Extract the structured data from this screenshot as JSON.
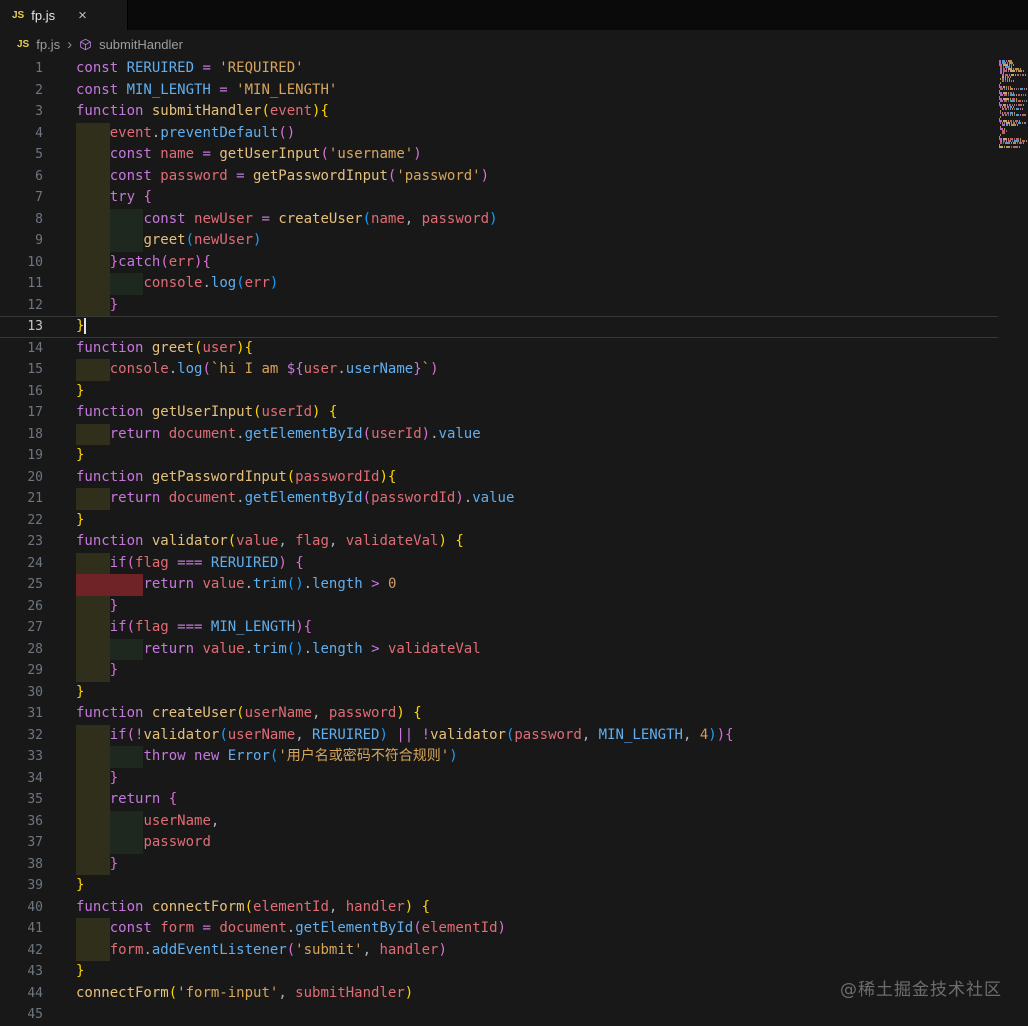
{
  "tab": {
    "icon_label": "JS",
    "title": "fp.js",
    "close_glyph": "×"
  },
  "breadcrumb": {
    "file_icon": "JS",
    "file": "fp.js",
    "separator": "›",
    "symbol": "submitHandler"
  },
  "editor": {
    "active_line": 13,
    "cursor_line": 13,
    "watermark": "@稀土掘金技术社区",
    "colors": {
      "editor_bg": "#181818",
      "tab_bar_bg": "#0a0a0a",
      "tab_active_bg": "#181818",
      "keyword": "#c678dd",
      "function_name": "#e5c07b",
      "variable": "#e06c75",
      "property": "#61afef",
      "string": "#d7a65c",
      "number": "#d19a66",
      "operator": "#c678dd",
      "punctuation": "#abb2bf",
      "bracket_depth_1": "#ffd700",
      "bracket_depth_2": "#da70d6",
      "bracket_depth_3": "#179fff",
      "line_number": "#6e7681",
      "line_number_active": "#c8c8c8",
      "indent_level_1": "rgba(255,255,64,0.10)",
      "indent_level_2": "rgba(127,255,127,0.07)",
      "indent_error": "rgba(150,40,44,0.70)",
      "js_icon": "#e8cf4e",
      "breadcrumb_text": "#9d9d9d",
      "symbol_icon": "#b180d7",
      "watermark": "rgba(235,235,235,0.40)"
    },
    "lines": [
      {
        "n": 1,
        "i": 0,
        "t": [
          [
            "kw",
            "const "
          ],
          [
            "bl",
            "RERUIRED "
          ],
          [
            "op",
            "= "
          ],
          [
            "st",
            "'REQUIRED'"
          ]
        ]
      },
      {
        "n": 2,
        "i": 0,
        "t": [
          [
            "kw",
            "const "
          ],
          [
            "bl",
            "MIN_LENGTH "
          ],
          [
            "op",
            "= "
          ],
          [
            "st",
            "'MIN_LENGTH'"
          ]
        ]
      },
      {
        "n": 3,
        "i": 0,
        "t": [
          [
            "kw",
            "function "
          ],
          [
            "fn",
            "submitHandler"
          ],
          [
            "br",
            "("
          ],
          [
            "vr",
            "event"
          ],
          [
            "br",
            "){"
          ]
        ]
      },
      {
        "n": 4,
        "i": 1,
        "t": [
          [
            "vr",
            "event"
          ],
          [
            "pn",
            "."
          ],
          [
            "bl",
            "preventDefault"
          ],
          [
            "br",
            "()"
          ]
        ]
      },
      {
        "n": 5,
        "i": 1,
        "t": [
          [
            "kw",
            "const "
          ],
          [
            "vr",
            "name "
          ],
          [
            "op",
            "= "
          ],
          [
            "fn",
            "getUserInput"
          ],
          [
            "br",
            "("
          ],
          [
            "st",
            "'username'"
          ],
          [
            "br",
            ")"
          ]
        ]
      },
      {
        "n": 6,
        "i": 1,
        "t": [
          [
            "kw",
            "const "
          ],
          [
            "vr",
            "password "
          ],
          [
            "op",
            "= "
          ],
          [
            "fn",
            "getPasswordInput"
          ],
          [
            "br",
            "("
          ],
          [
            "st",
            "'password'"
          ],
          [
            "br",
            ")"
          ]
        ]
      },
      {
        "n": 7,
        "i": 1,
        "t": [
          [
            "kw",
            "try "
          ],
          [
            "br",
            "{"
          ]
        ]
      },
      {
        "n": 8,
        "i": 2,
        "t": [
          [
            "kw",
            "const "
          ],
          [
            "vr",
            "newUser "
          ],
          [
            "op",
            "= "
          ],
          [
            "fn",
            "createUser"
          ],
          [
            "br",
            "("
          ],
          [
            "vr",
            "name"
          ],
          [
            "pn",
            ", "
          ],
          [
            "vr",
            "password"
          ],
          [
            "br",
            ")"
          ]
        ]
      },
      {
        "n": 9,
        "i": 2,
        "t": [
          [
            "fn",
            "greet"
          ],
          [
            "br",
            "("
          ],
          [
            "vr",
            "newUser"
          ],
          [
            "br",
            ")"
          ]
        ]
      },
      {
        "n": 10,
        "i": 1,
        "t": [
          [
            "br",
            "}"
          ],
          [
            "kw",
            "catch"
          ],
          [
            "br",
            "("
          ],
          [
            "vr",
            "err"
          ],
          [
            "br",
            "){"
          ]
        ]
      },
      {
        "n": 11,
        "i": 2,
        "t": [
          [
            "vr",
            "console"
          ],
          [
            "pn",
            "."
          ],
          [
            "bl",
            "log"
          ],
          [
            "br",
            "("
          ],
          [
            "vr",
            "err"
          ],
          [
            "br",
            ")"
          ]
        ]
      },
      {
        "n": 12,
        "i": 1,
        "t": [
          [
            "br",
            "}"
          ]
        ]
      },
      {
        "n": 13,
        "i": 0,
        "t": [
          [
            "br",
            "}"
          ]
        ]
      },
      {
        "n": 14,
        "i": 0,
        "t": [
          [
            "kw",
            "function "
          ],
          [
            "fn",
            "greet"
          ],
          [
            "br",
            "("
          ],
          [
            "vr",
            "user"
          ],
          [
            "br",
            "){"
          ]
        ]
      },
      {
        "n": 15,
        "i": 1,
        "t": [
          [
            "vr",
            "console"
          ],
          [
            "pn",
            "."
          ],
          [
            "bl",
            "log"
          ],
          [
            "br",
            "("
          ],
          [
            "st",
            "`hi I am "
          ],
          [
            "op",
            "${"
          ],
          [
            "vr",
            "user"
          ],
          [
            "pn",
            "."
          ],
          [
            "bl",
            "userName"
          ],
          [
            "op",
            "}"
          ],
          [
            "st",
            "`"
          ],
          [
            "br",
            ")"
          ]
        ]
      },
      {
        "n": 16,
        "i": 0,
        "t": [
          [
            "br",
            "}"
          ]
        ]
      },
      {
        "n": 17,
        "i": 0,
        "t": [
          [
            "kw",
            "function "
          ],
          [
            "fn",
            "getUserInput"
          ],
          [
            "br",
            "("
          ],
          [
            "vr",
            "userId"
          ],
          [
            "br",
            ") {"
          ]
        ]
      },
      {
        "n": 18,
        "i": 1,
        "t": [
          [
            "kw",
            "return "
          ],
          [
            "vr",
            "document"
          ],
          [
            "pn",
            "."
          ],
          [
            "bl",
            "getElementById"
          ],
          [
            "br",
            "("
          ],
          [
            "vr",
            "userId"
          ],
          [
            "br",
            ")"
          ],
          [
            "pn",
            "."
          ],
          [
            "bl",
            "value"
          ]
        ]
      },
      {
        "n": 19,
        "i": 0,
        "t": [
          [
            "br",
            "}"
          ]
        ]
      },
      {
        "n": 20,
        "i": 0,
        "t": [
          [
            "kw",
            "function "
          ],
          [
            "fn",
            "getPasswordInput"
          ],
          [
            "br",
            "("
          ],
          [
            "vr",
            "passwordId"
          ],
          [
            "br",
            "){"
          ]
        ]
      },
      {
        "n": 21,
        "i": 1,
        "t": [
          [
            "kw",
            "return "
          ],
          [
            "vr",
            "document"
          ],
          [
            "pn",
            "."
          ],
          [
            "bl",
            "getElementById"
          ],
          [
            "br",
            "("
          ],
          [
            "vr",
            "passwordId"
          ],
          [
            "br",
            ")"
          ],
          [
            "pn",
            "."
          ],
          [
            "bl",
            "value"
          ]
        ]
      },
      {
        "n": 22,
        "i": 0,
        "t": [
          [
            "br",
            "}"
          ]
        ]
      },
      {
        "n": 23,
        "i": 0,
        "t": [
          [
            "kw",
            "function "
          ],
          [
            "fn",
            "validator"
          ],
          [
            "br",
            "("
          ],
          [
            "vr",
            "value"
          ],
          [
            "pn",
            ", "
          ],
          [
            "vr",
            "flag"
          ],
          [
            "pn",
            ", "
          ],
          [
            "vr",
            "validateVal"
          ],
          [
            "br",
            ") {"
          ]
        ]
      },
      {
        "n": 24,
        "i": 1,
        "t": [
          [
            "kw",
            "if"
          ],
          [
            "br",
            "("
          ],
          [
            "vr",
            "flag "
          ],
          [
            "op",
            "=== "
          ],
          [
            "bl",
            "RERUIRED"
          ],
          [
            "br",
            ") {"
          ]
        ]
      },
      {
        "n": 25,
        "i": 2,
        "e": true,
        "t": [
          [
            "kw",
            "return "
          ],
          [
            "vr",
            "value"
          ],
          [
            "pn",
            "."
          ],
          [
            "bl",
            "trim"
          ],
          [
            "br",
            "()"
          ],
          [
            "pn",
            "."
          ],
          [
            "bl",
            "length "
          ],
          [
            "op",
            "> "
          ],
          [
            "nm",
            "0"
          ]
        ]
      },
      {
        "n": 26,
        "i": 1,
        "t": [
          [
            "br",
            "}"
          ]
        ]
      },
      {
        "n": 27,
        "i": 1,
        "t": [
          [
            "kw",
            "if"
          ],
          [
            "br",
            "("
          ],
          [
            "vr",
            "flag "
          ],
          [
            "op",
            "=== "
          ],
          [
            "bl",
            "MIN_LENGTH"
          ],
          [
            "br",
            "){"
          ]
        ]
      },
      {
        "n": 28,
        "i": 2,
        "t": [
          [
            "kw",
            "return "
          ],
          [
            "vr",
            "value"
          ],
          [
            "pn",
            "."
          ],
          [
            "bl",
            "trim"
          ],
          [
            "br",
            "()"
          ],
          [
            "pn",
            "."
          ],
          [
            "bl",
            "length "
          ],
          [
            "op",
            "> "
          ],
          [
            "vr",
            "validateVal"
          ]
        ]
      },
      {
        "n": 29,
        "i": 1,
        "t": [
          [
            "br",
            "}"
          ]
        ]
      },
      {
        "n": 30,
        "i": 0,
        "t": [
          [
            "br",
            "}"
          ]
        ]
      },
      {
        "n": 31,
        "i": 0,
        "t": [
          [
            "kw",
            "function "
          ],
          [
            "fn",
            "createUser"
          ],
          [
            "br",
            "("
          ],
          [
            "vr",
            "userName"
          ],
          [
            "pn",
            ", "
          ],
          [
            "vr",
            "password"
          ],
          [
            "br",
            ") {"
          ]
        ]
      },
      {
        "n": 32,
        "i": 1,
        "t": [
          [
            "kw",
            "if"
          ],
          [
            "br",
            "("
          ],
          [
            "op",
            "!"
          ],
          [
            "fn",
            "validator"
          ],
          [
            "br",
            "("
          ],
          [
            "vr",
            "userName"
          ],
          [
            "pn",
            ", "
          ],
          [
            "bl",
            "RERUIRED"
          ],
          [
            "br",
            ")"
          ],
          [
            "op",
            " || !"
          ],
          [
            "fn",
            "validator"
          ],
          [
            "br",
            "("
          ],
          [
            "vr",
            "password"
          ],
          [
            "pn",
            ", "
          ],
          [
            "bl",
            "MIN_LENGTH"
          ],
          [
            "pn",
            ", "
          ],
          [
            "nm",
            "4"
          ],
          [
            "br",
            ")){"
          ]
        ]
      },
      {
        "n": 33,
        "i": 2,
        "t": [
          [
            "kw",
            "throw new "
          ],
          [
            "bl",
            "Error"
          ],
          [
            "br",
            "("
          ],
          [
            "st",
            "'用户名或密码不符合规则'"
          ],
          [
            "br",
            ")"
          ]
        ]
      },
      {
        "n": 34,
        "i": 1,
        "t": [
          [
            "br",
            "}"
          ]
        ]
      },
      {
        "n": 35,
        "i": 1,
        "t": [
          [
            "kw",
            "return "
          ],
          [
            "br",
            "{"
          ]
        ]
      },
      {
        "n": 36,
        "i": 2,
        "t": [
          [
            "vr",
            "userName"
          ],
          [
            "pn",
            ","
          ]
        ]
      },
      {
        "n": 37,
        "i": 2,
        "t": [
          [
            "vr",
            "password"
          ]
        ]
      },
      {
        "n": 38,
        "i": 1,
        "t": [
          [
            "br",
            "}"
          ]
        ]
      },
      {
        "n": 39,
        "i": 0,
        "t": [
          [
            "br",
            "}"
          ]
        ]
      },
      {
        "n": 40,
        "i": 0,
        "t": [
          [
            "kw",
            "function "
          ],
          [
            "fn",
            "connectForm"
          ],
          [
            "br",
            "("
          ],
          [
            "vr",
            "elementId"
          ],
          [
            "pn",
            ", "
          ],
          [
            "vr",
            "handler"
          ],
          [
            "br",
            ") {"
          ]
        ]
      },
      {
        "n": 41,
        "i": 1,
        "t": [
          [
            "kw",
            "const "
          ],
          [
            "vr",
            "form "
          ],
          [
            "op",
            "= "
          ],
          [
            "vr",
            "document"
          ],
          [
            "pn",
            "."
          ],
          [
            "bl",
            "getElementById"
          ],
          [
            "br",
            "("
          ],
          [
            "vr",
            "elementId"
          ],
          [
            "br",
            ")"
          ]
        ]
      },
      {
        "n": 42,
        "i": 1,
        "t": [
          [
            "vr",
            "form"
          ],
          [
            "pn",
            "."
          ],
          [
            "bl",
            "addEventListener"
          ],
          [
            "br",
            "("
          ],
          [
            "st",
            "'submit'"
          ],
          [
            "pn",
            ", "
          ],
          [
            "vr",
            "handler"
          ],
          [
            "br",
            ")"
          ]
        ]
      },
      {
        "n": 43,
        "i": 0,
        "t": [
          [
            "br",
            "}"
          ]
        ]
      },
      {
        "n": 44,
        "i": 0,
        "t": [
          [
            "fn",
            "connectForm"
          ],
          [
            "br",
            "("
          ],
          [
            "st",
            "'form-input'"
          ],
          [
            "pn",
            ", "
          ],
          [
            "vr",
            "submitHandler"
          ],
          [
            "br",
            ")"
          ]
        ]
      },
      {
        "n": 45,
        "i": 0,
        "t": []
      }
    ]
  }
}
